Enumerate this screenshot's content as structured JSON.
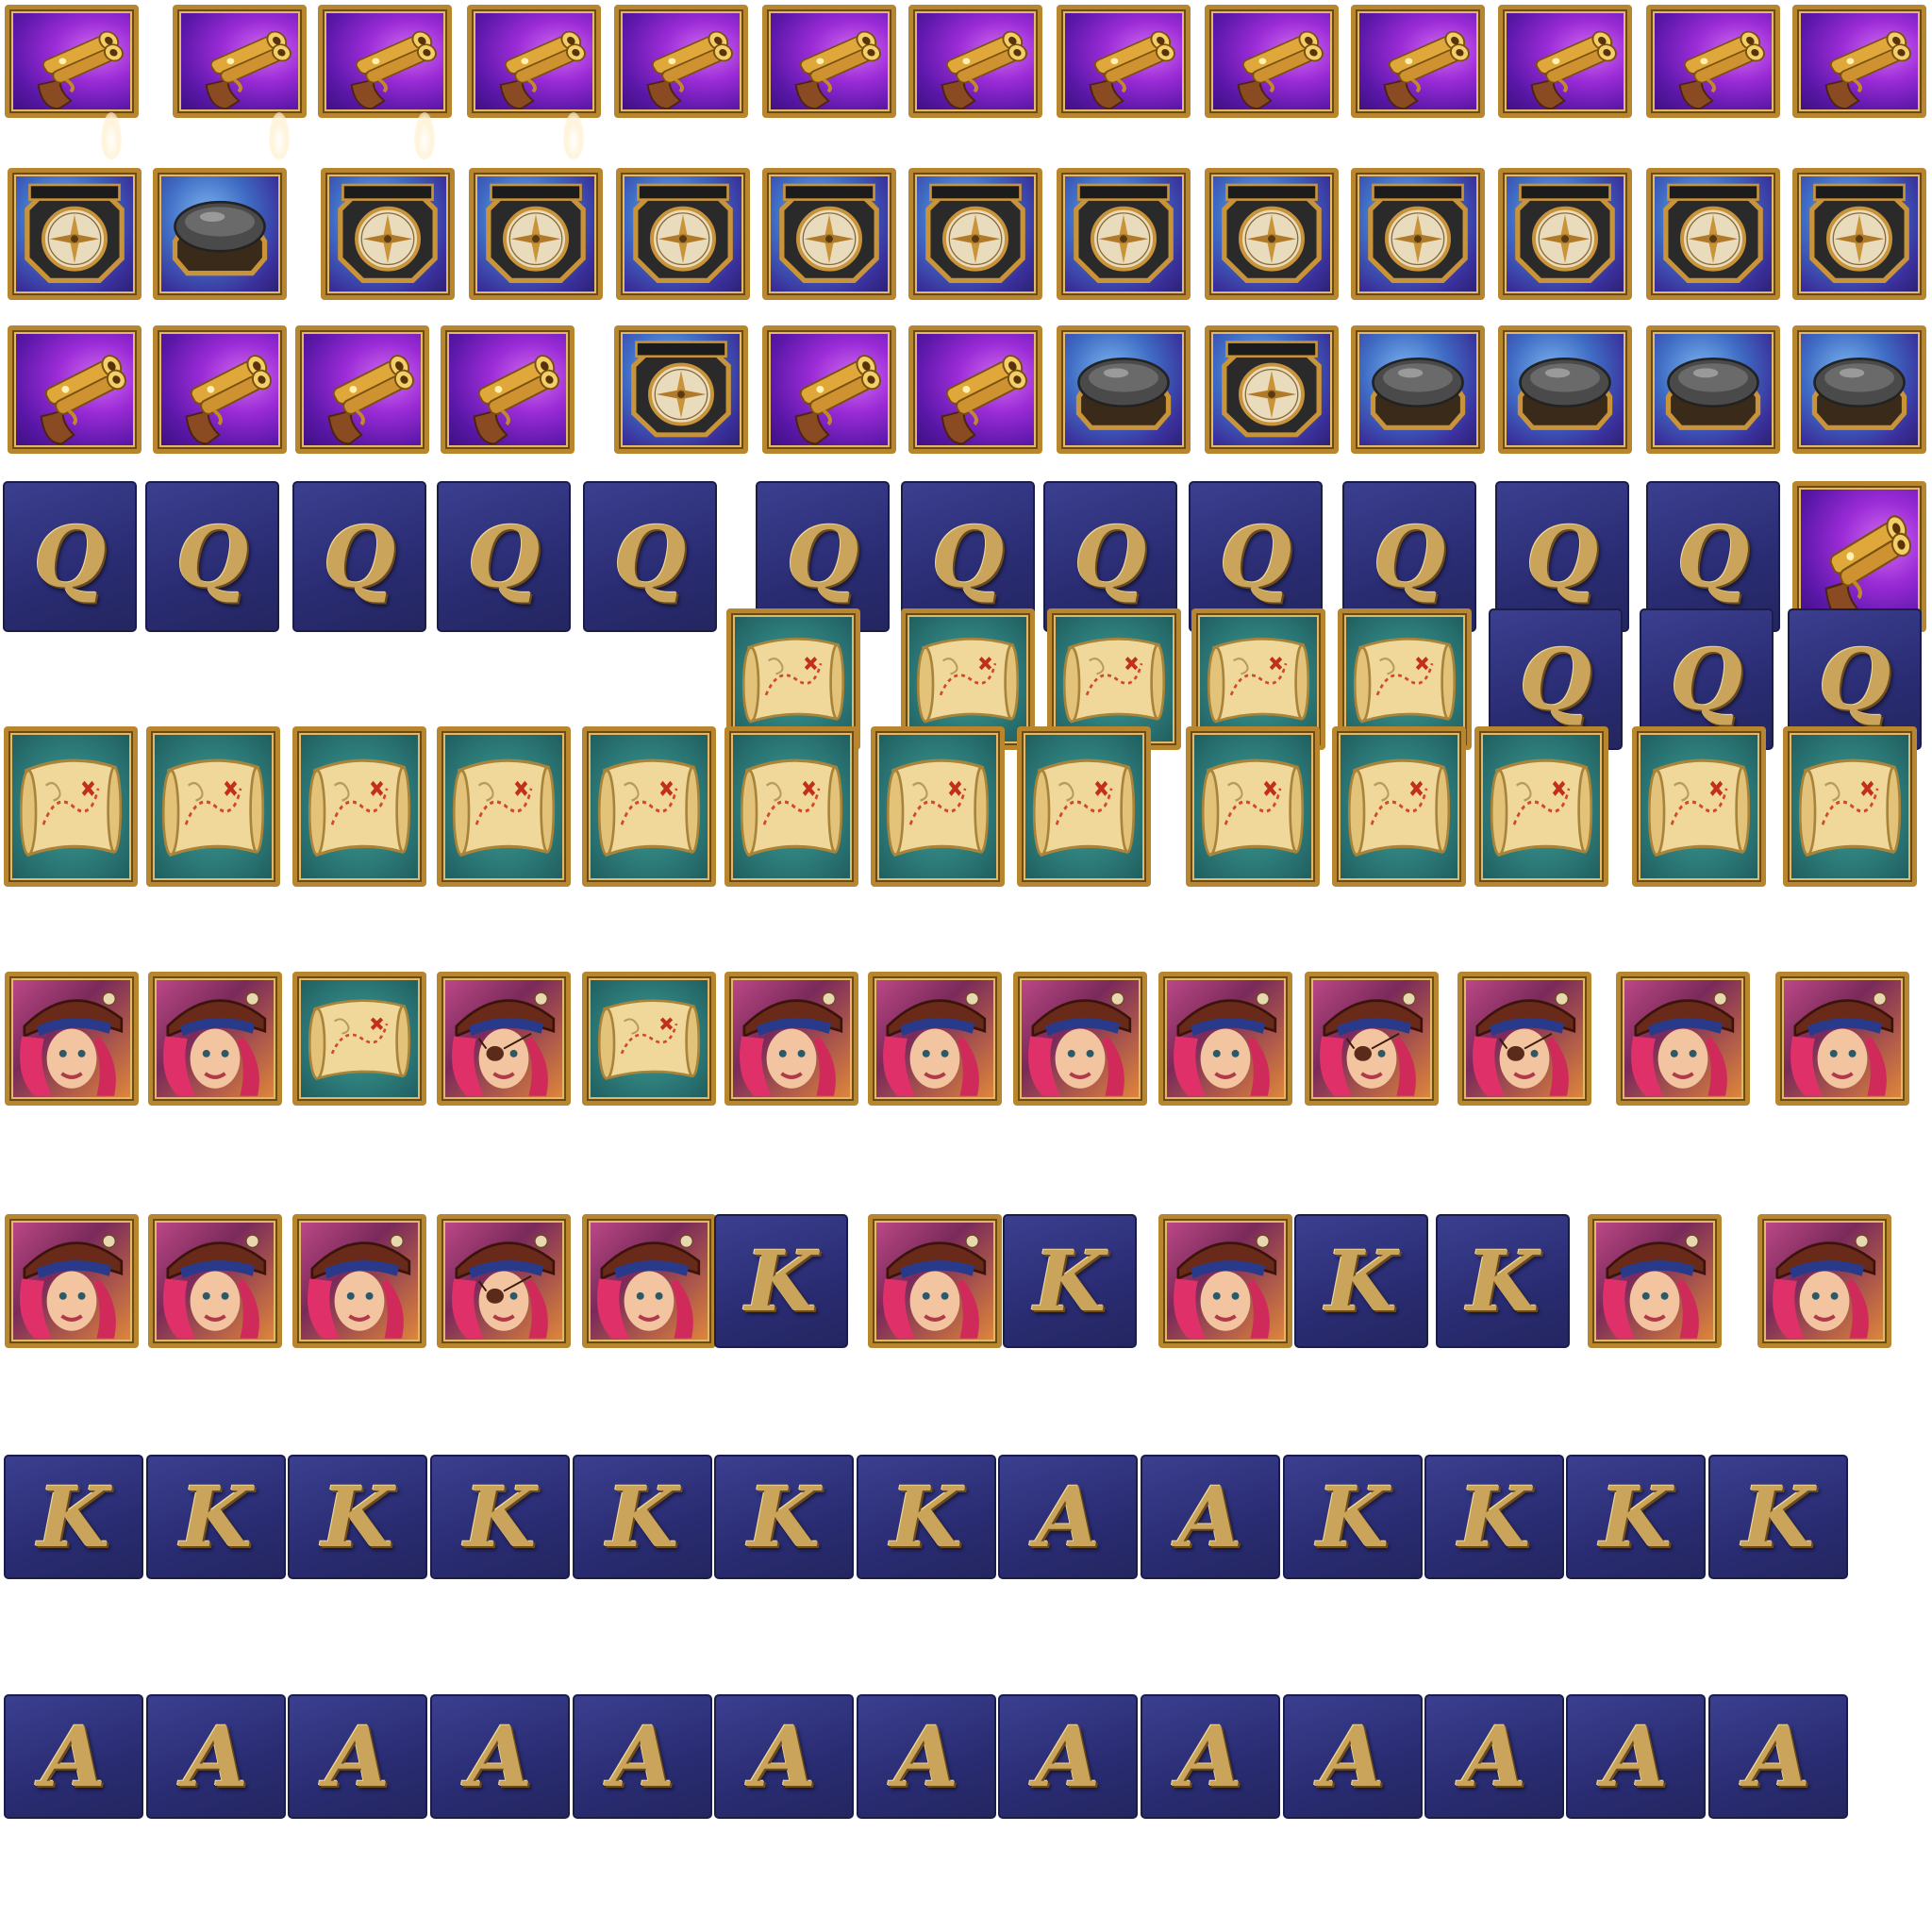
{
  "sheet": {
    "title": ""
  },
  "symbols": {
    "queen": "Q",
    "king": "K",
    "ace": "A"
  },
  "icons": {
    "pistol": "flintlock-pistol-icon",
    "compass": "compass-icon",
    "map": "treasure-map-icon",
    "pirate": "pirate-captain-icon"
  },
  "colors": {
    "frame_gold": "#b8862f",
    "letter_bg": "#2a2c73",
    "letter_gold": "#c9a45a",
    "pistol_purple": "#9a2bd6",
    "compass_blue": "#3f6cc4",
    "map_teal": "#2c7a78"
  },
  "rows": [
    {
      "id": "row-1",
      "sequence": [
        "pistol-fire",
        "pistol-fire",
        "pistol-fire",
        "pistol-fire",
        "pistol",
        "pistol",
        "pistol",
        "pistol",
        "pistol",
        "pistol",
        "pistol",
        "pistol",
        "pistol"
      ]
    },
    {
      "id": "row-2",
      "sequence": [
        "compass",
        "compass-closing",
        "compass",
        "compass",
        "compass",
        "compass",
        "compass",
        "compass",
        "compass",
        "compass",
        "compass",
        "compass",
        "compass"
      ]
    },
    {
      "id": "row-3",
      "sequence": [
        "pistol",
        "pistol",
        "pistol",
        "pistol",
        "compass",
        "pistol",
        "pistol",
        "compass-closing",
        "compass",
        "compass-closed",
        "compass-closed",
        "compass-closed",
        "compass-closed"
      ]
    },
    {
      "id": "row-4",
      "sequence": [
        "Q",
        "Q",
        "Q",
        "Q",
        "Q",
        "Q",
        "Q",
        "Q",
        "Q",
        "Q",
        "Q",
        "Q",
        "pistol"
      ]
    },
    {
      "id": "row-5",
      "sequence": [
        "map",
        "map",
        "map",
        "map",
        "map",
        "Q",
        "Q",
        "Q"
      ]
    },
    {
      "id": "row-6",
      "sequence": [
        "map",
        "map",
        "map",
        "map",
        "map",
        "map",
        "map",
        "map",
        "map",
        "map",
        "map",
        "map",
        "map"
      ]
    },
    {
      "id": "row-7",
      "sequence": [
        "pirate",
        "pirate",
        "map",
        "pirate",
        "map",
        "pirate",
        "pirate",
        "pirate",
        "pirate",
        "pirate",
        "pirate",
        "pirate",
        "pirate"
      ]
    },
    {
      "id": "row-8",
      "sequence": [
        "pirate",
        "pirate",
        "pirate",
        "pirate",
        "pirate",
        "K",
        "pirate",
        "K",
        "pirate",
        "K",
        "K",
        "pirate",
        "pirate"
      ]
    },
    {
      "id": "row-9",
      "sequence": [
        "K",
        "K",
        "K",
        "K",
        "K",
        "K",
        "K",
        "A",
        "A",
        "K",
        "K",
        "K",
        "K"
      ]
    },
    {
      "id": "row-10",
      "sequence": [
        "A",
        "A",
        "A",
        "A",
        "A",
        "A",
        "A",
        "A",
        "A",
        "A",
        "A",
        "A",
        "A"
      ]
    }
  ]
}
